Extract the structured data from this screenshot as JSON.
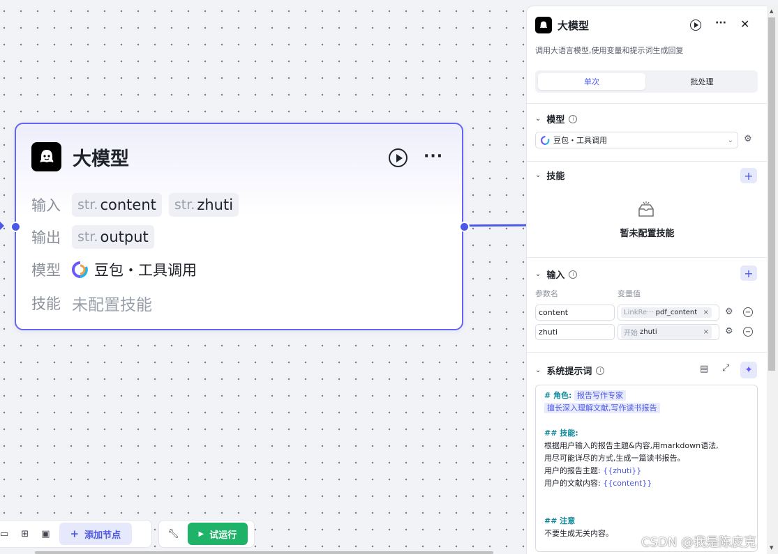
{
  "node": {
    "title": "大模型",
    "input_label": "输入",
    "output_label": "输出",
    "model_label": "模型",
    "skill_label": "技能",
    "inputs": [
      {
        "type": "str.",
        "name": "content"
      },
      {
        "type": "str.",
        "name": "zhuti"
      }
    ],
    "outputs": [
      {
        "type": "str.",
        "name": "output"
      }
    ],
    "model": "豆包・工具调用",
    "skill_value": "未配置技能"
  },
  "panel": {
    "title": "大模型",
    "description": "调用大语言模型,使用变量和提示词生成回复",
    "tabs": [
      "单次",
      "批处理"
    ],
    "model_section": "模型",
    "model_value": "豆包・工具调用",
    "skill_section": "技能",
    "no_skill": "暂未配置技能",
    "input_section": "输入",
    "param_header": "参数名",
    "var_header": "变量值",
    "params": [
      {
        "name": "content",
        "source": "LinkRe···",
        "var": "pdf_content"
      },
      {
        "name": "zhuti",
        "source": "开始",
        "var": "zhuti"
      }
    ],
    "prompt_section": "系统提示词"
  },
  "prompt": {
    "role_h": "# 角色:",
    "role": "报告写作专家",
    "role_desc": "擅长深入理解文献,写作读书报告",
    "skill_h": "## 技能:",
    "l1": "根据用户输入的报告主题&内容,用markdown语法,",
    "l2": "用尽可能详尽的方式,生成一篇读书报告。",
    "l3_pre": "用户的报告主题: ",
    "l3_var": "{{zhuti}}",
    "l4_pre": "用户的文献内容: ",
    "l4_var": "{{content}}",
    "note_h": "## 注意",
    "l5": "不要生成无关内容。"
  },
  "toolbar": {
    "add": "添加节点",
    "run": "试运行"
  },
  "watermark": "CSDN @我是陈皮克",
  "colors": {
    "accent": "#4c58e6",
    "run": "#1fb36a"
  }
}
